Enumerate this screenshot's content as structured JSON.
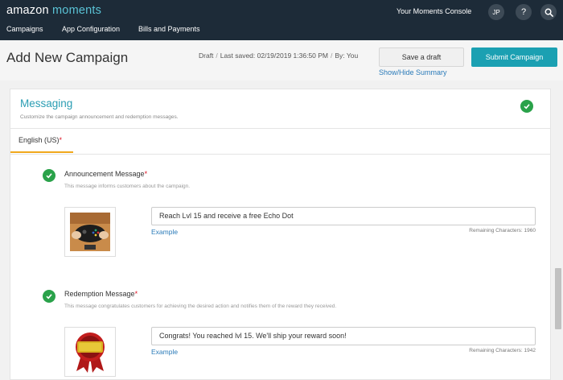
{
  "brand": {
    "name_part1": "amazon",
    "name_part2": "moments"
  },
  "topbar": {
    "console_label": "Your Moments Console",
    "avatar_initials": "JP",
    "help_label": "?",
    "nav": [
      "Campaigns",
      "App Configuration",
      "Bills and Payments"
    ]
  },
  "header": {
    "title": "Add New Campaign",
    "status": "Draft",
    "last_saved": "Last saved: 02/19/2019 1:36:50 PM",
    "by": "By: You",
    "save_draft_label": "Save a draft",
    "submit_label": "Submit Campaign",
    "toggle_summary_label": "Show/Hide Summary"
  },
  "section": {
    "title": "Messaging",
    "description": "Customize the campaign announcement and redemption messages.",
    "tab_label": "English (US)",
    "required_mark": "*"
  },
  "announcement": {
    "label": "Announcement Message",
    "required_mark": "*",
    "help": "This message informs customers about the campaign.",
    "value": "Reach Lvl 15 and receive a free Echo Dot",
    "example_label": "Example",
    "remaining": "Remaining Characters: 1960"
  },
  "redemption": {
    "label": "Redemption Message",
    "required_mark": "*",
    "help": "This message congratulates customers for achieving the desired action and notifies them of the reward they received.",
    "value": "Congrats! You reached lvl 15. We'll ship your reward soon!",
    "example_label": "Example",
    "remaining": "Remaining Characters: 1942"
  },
  "colors": {
    "topbar": "#1d2b38",
    "accent": "#1ba0b2",
    "title_teal": "#2a9db3",
    "link": "#2b7bb9",
    "success": "#2aa24a",
    "tab_underline": "#f0a81c"
  },
  "icons": [
    "search-icon",
    "help-icon",
    "check-circle-icon",
    "game-controller-image",
    "award-ribbon-image"
  ]
}
